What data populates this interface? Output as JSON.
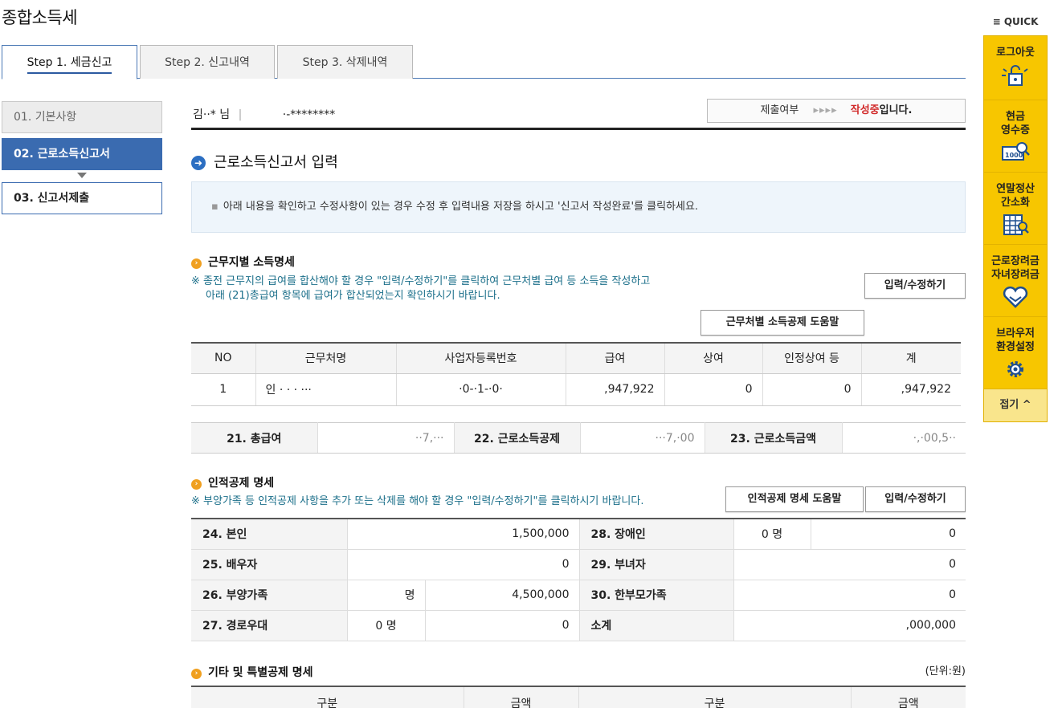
{
  "page_title": "종합소득세",
  "tabs": [
    {
      "label": "Step 1. 세금신고",
      "active": true
    },
    {
      "label": "Step 2. 신고내역",
      "active": false
    },
    {
      "label": "Step 3. 삭제내역",
      "active": false
    }
  ],
  "side_steps": [
    {
      "label": "01. 기본사항",
      "state": "done"
    },
    {
      "label": "02. 근로소득신고서",
      "state": "active"
    },
    {
      "label": "03. 신고서제출",
      "state": "next"
    }
  ],
  "user": {
    "name": "김··* 님",
    "sep": "|",
    "id": "·-********"
  },
  "status": {
    "label": "제출여부",
    "arrows": "▸▸▸▸",
    "value_red": "작성중",
    "value_suffix": "입니다."
  },
  "section_title": "근로소득신고서 입력",
  "notice": "아래 내용을 확인하고 수정사항이 있는 경우 수정 후 입력내용 저장을 하시고 '신고서 작성완료'를 클릭하세요.",
  "income": {
    "title": "근무지별 소득명세",
    "note_line1": "※ 종전 근무지의 급여를 합산해야 할 경우 \"입력/수정하기\"를 클릭하여 근무처별 급여 등 소득을 작성하고",
    "note_line2": "아래 (21)총급여 항목에 급여가 합산되었는지 확인하시기 바랍니다.",
    "edit_button": "입력/수정하기",
    "help_button": "근무처별 소득공제 도움말",
    "headers": [
      "NO",
      "근무처명",
      "사업자등록번호",
      "급여",
      "상여",
      "인정상여 등",
      "계"
    ],
    "rows": [
      [
        "1",
        "인 ·  · · ···",
        "·0-·1-·0·",
        ",947,922",
        "0",
        "0",
        ",947,922"
      ]
    ]
  },
  "summary": {
    "labels": [
      "21. 총급여",
      "22. 근로소득공제",
      "23. 근로소득금액"
    ],
    "values": [
      "··7,···",
      "···7,·00",
      "·,·00,5··"
    ]
  },
  "personal": {
    "title": "인적공제 명세",
    "note": "※ 부양가족 등 인적공제 사항을 추가 또는 삭제를 해야 할 경우 \"입력/수정하기\"를 클릭하시기 바랍니다.",
    "help_button": "인적공제 명세 도움말",
    "edit_button": "입력/수정하기",
    "r24": {
      "label": "24. 본인",
      "value": "1,500,000"
    },
    "r25": {
      "label": "25. 배우자",
      "value": "0"
    },
    "r26": {
      "label": "26. 부양가족",
      "count": "명",
      "value": "4,500,000"
    },
    "r27": {
      "label": "27. 경로우대",
      "count": "0  명",
      "value": "0"
    },
    "r28": {
      "label": "28. 장애인",
      "count": "0  명",
      "value": "0"
    },
    "r29": {
      "label": "29. 부녀자",
      "value": "0"
    },
    "r30": {
      "label": "30. 한부모가족",
      "value": "0"
    },
    "subtotal": {
      "label": "소계",
      "value": ",000,000"
    }
  },
  "other": {
    "title": "기타 및 특별공제 명세",
    "unit": "(단위:원)",
    "headers": [
      "구분",
      "금액",
      "구분",
      "금액"
    ]
  },
  "quick": {
    "header": "≡ QUICK",
    "items": [
      {
        "label1": "로그아웃",
        "label2": "",
        "icon": "logout-lock-icon"
      },
      {
        "label1": "현금",
        "label2": "영수증",
        "icon": "receipt-1000-icon"
      },
      {
        "label1": "연말정산",
        "label2": "간소화",
        "icon": "calculator-search-icon"
      },
      {
        "label1": "근로장려금",
        "label2": "자녀장려금",
        "icon": "heart-hands-icon"
      },
      {
        "label1": "브라우저",
        "label2": "환경설정",
        "icon": "gear-icon"
      }
    ],
    "close": "접기 ^"
  }
}
